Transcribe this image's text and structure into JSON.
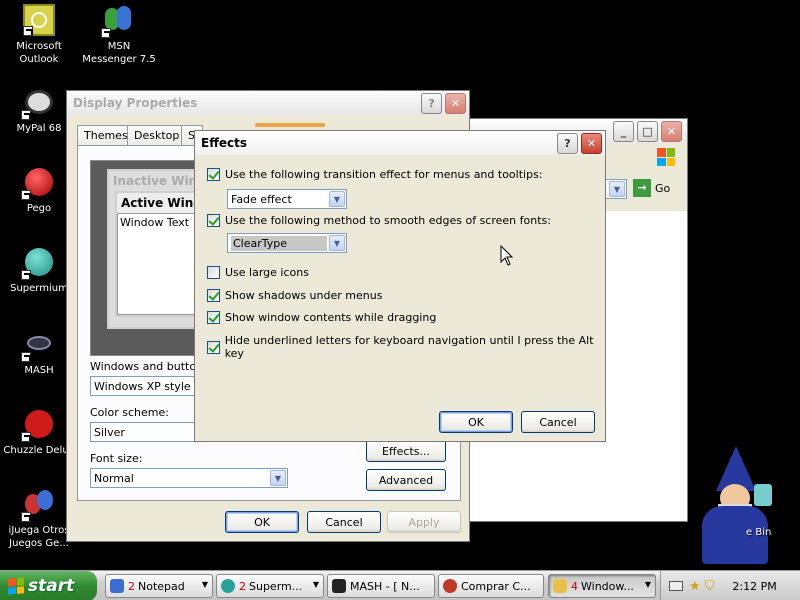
{
  "desktop_icons": [
    {
      "label": "Microsoft Outlook",
      "icon": "outlook-icon"
    },
    {
      "label": "MSN Messenger 7.5",
      "icon": "msn-messenger-icon"
    },
    {
      "label": "MyPal 68",
      "icon": "mypal-icon"
    },
    {
      "label": "Pego",
      "icon": "pego-icon"
    },
    {
      "label": "Supermium",
      "icon": "supermium-icon"
    },
    {
      "label": "MASH",
      "icon": "mash-icon"
    },
    {
      "label": "Chuzzle Delux",
      "icon": "chuzzle-icon"
    },
    {
      "label": "iJuega Otros Juegos Ge...",
      "icon": "ijuega-icon"
    },
    {
      "label": "e Bin",
      "icon": "recycle-bin-icon"
    }
  ],
  "display_properties": {
    "title": "Display Properties",
    "tabs": [
      "Themes",
      "Desktop",
      "S"
    ],
    "preview": {
      "inactive": "Inactive Wind",
      "active": "Active Wind",
      "window_text": "Window Text"
    },
    "windows_buttons_label": "Windows and buttons",
    "windows_buttons_value": "Windows XP style",
    "color_scheme_label": "Color scheme:",
    "color_scheme_value": "Silver",
    "font_size_label": "Font size:",
    "font_size_value": "Normal",
    "effects_button": "Effects...",
    "advanced_button": "Advanced",
    "ok": "OK",
    "cancel": "Cancel",
    "apply": "Apply"
  },
  "explorer": {
    "go_label": "Go"
  },
  "effects": {
    "title": "Effects",
    "options": [
      {
        "label": "Use the following transition effect for menus and tooltips:",
        "checked": true
      },
      {
        "label": "Use the following method to smooth edges of screen fonts:",
        "checked": true
      },
      {
        "label": "Use large icons",
        "checked": false
      },
      {
        "label": "Show shadows under menus",
        "checked": true
      },
      {
        "label": "Show window contents while dragging",
        "checked": true
      },
      {
        "label": "Hide underlined letters for keyboard navigation until I press the Alt key",
        "checked": true
      }
    ],
    "transition_value": "Fade effect",
    "smoothing_value": "ClearType",
    "ok": "OK",
    "cancel": "Cancel"
  },
  "taskbar": {
    "start": "start",
    "tasks": [
      {
        "count": "2",
        "label": "Notepad",
        "icon": "notepad-icon",
        "color": "#3b6ccf"
      },
      {
        "count": "2",
        "label": "Superm...",
        "icon": "supermium-icon",
        "color": "#2aa198"
      },
      {
        "count": "",
        "label": "MASH - [ N...",
        "icon": "mash-icon",
        "color": "#222222"
      },
      {
        "count": "",
        "label": "Comprar C...",
        "icon": "browser-icon",
        "color": "#c0392b"
      },
      {
        "count": "4",
        "label": "Window...",
        "icon": "folder-icon",
        "color": "#e8c14a"
      }
    ],
    "clock": "2:12 PM"
  }
}
